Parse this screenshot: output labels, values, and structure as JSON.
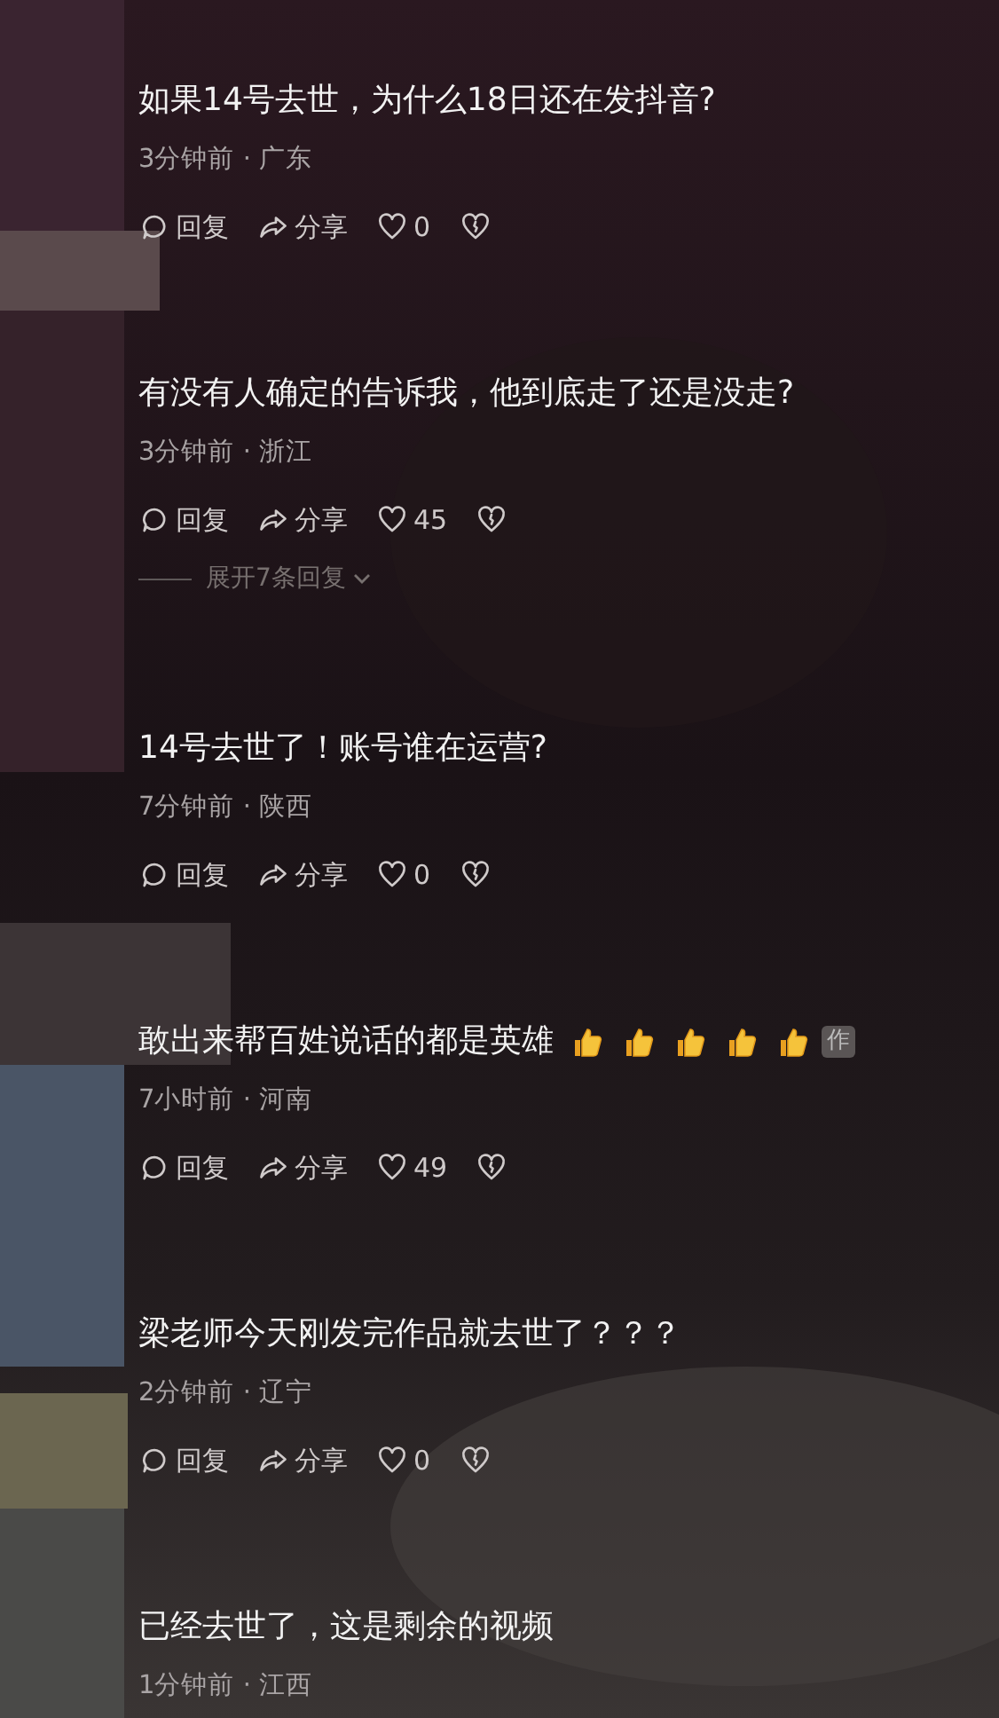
{
  "comments": [
    {
      "text": "如果14号去世，为什么18日还在发抖音?",
      "meta": "3分钟前 · 广东",
      "reply_label": "回复",
      "share_label": "分享",
      "likes": "0"
    },
    {
      "text": "有没有人确定的告诉我，他到底走了还是没走?",
      "meta": "3分钟前 · 浙江",
      "reply_label": "回复",
      "share_label": "分享",
      "likes": "45",
      "expand_label": "展开7条回复"
    },
    {
      "text": "14号去世了！账号谁在运营?",
      "meta": "7分钟前 · 陕西",
      "reply_label": "回复",
      "share_label": "分享",
      "likes": "0"
    },
    {
      "text": "敢出来帮百姓说话的都是英雄",
      "reactions": [
        {
          "kind": "thumbs-up"
        },
        {
          "kind": "thumbs-up"
        },
        {
          "kind": "thumbs-up"
        },
        {
          "kind": "thumbs-up"
        },
        {
          "kind": "thumbs-up"
        }
      ],
      "tag": "作",
      "meta": "7小时前 · 河南",
      "reply_label": "回复",
      "share_label": "分享",
      "likes": "49"
    },
    {
      "text": "梁老师今天刚发完作品就去世了？？？",
      "meta": "2分钟前 · 辽宁",
      "reply_label": "回复",
      "share_label": "分享",
      "likes": "0"
    },
    {
      "text": "已经去世了，这是剩余的视频",
      "meta": "1分钟前 · 江西"
    }
  ]
}
